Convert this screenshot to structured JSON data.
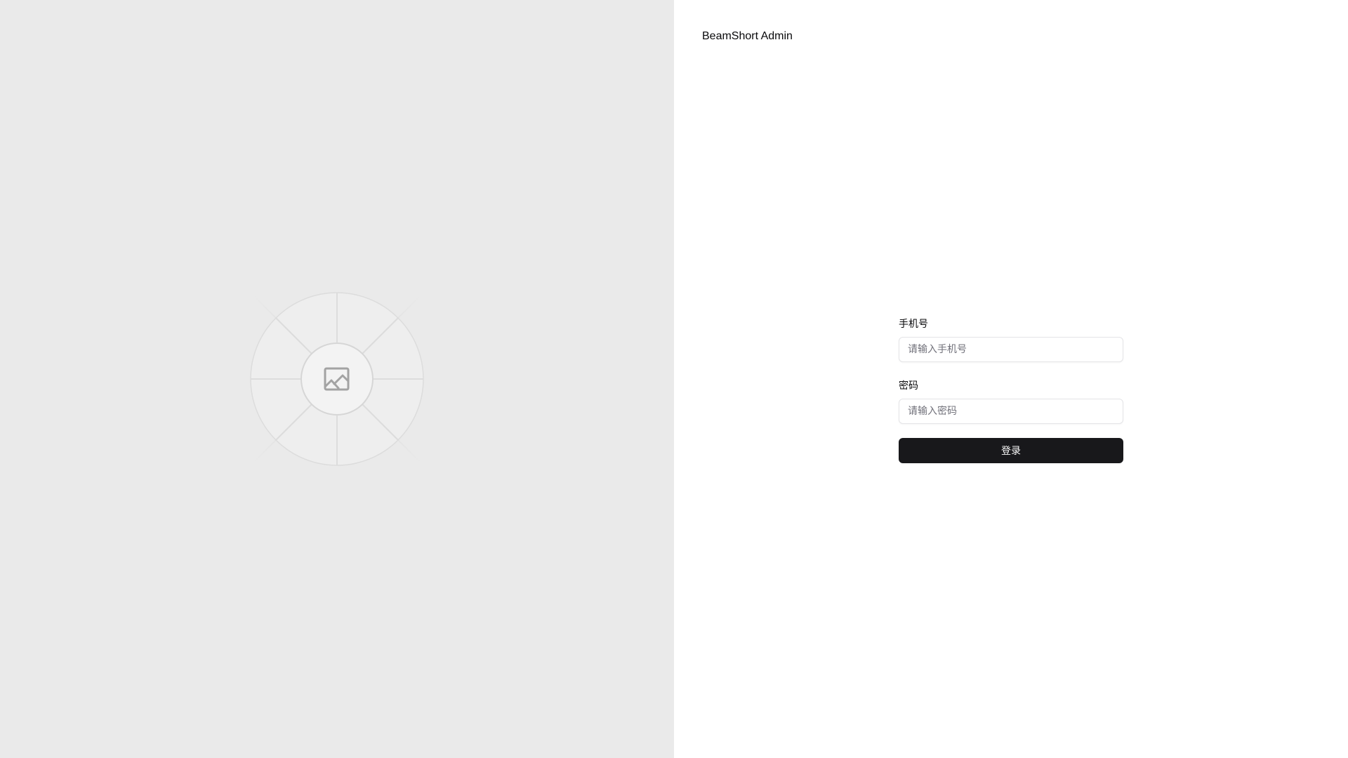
{
  "brand": {
    "title": "BeamShort Admin"
  },
  "hero": {
    "icon": "image-placeholder-icon"
  },
  "form": {
    "phone_label": "手机号",
    "phone_placeholder": "请输入手机号",
    "phone_value": "",
    "password_label": "密码",
    "password_placeholder": "请输入密码",
    "password_value": "",
    "submit_label": "登录"
  },
  "colors": {
    "hero_background": "#eaeaea",
    "button_background": "#18181b",
    "button_text": "#fafafa",
    "input_border": "#e4e4e7"
  }
}
